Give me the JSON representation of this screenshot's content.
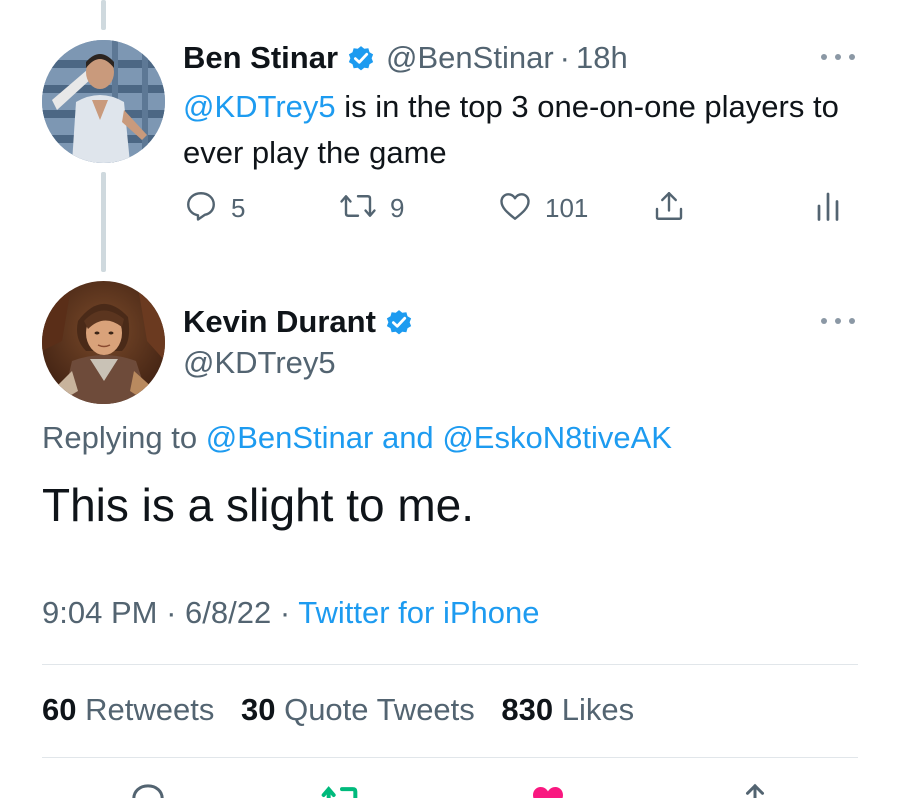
{
  "parent_tweet": {
    "author_name": "Ben Stinar",
    "handle": "@BenStinar",
    "separator": "·",
    "time": "18h",
    "mention": "@KDTrey5",
    "text": " is in the top 3 one-on-one players to ever play the game",
    "actions": {
      "replies": "5",
      "retweets": "9",
      "likes": "101"
    }
  },
  "reply_tweet": {
    "author_name": "Kevin Durant",
    "handle": "@KDTrey5",
    "replying_prefix": "Replying to",
    "replying_user_1": "@BenStinar",
    "replying_and": "and",
    "replying_user_2": "@EskoN8tiveAK",
    "text": "This is a slight to me.",
    "time": "9:04 PM",
    "date": "6/8/22",
    "separator": "·",
    "source": "Twitter for iPhone"
  },
  "stats": {
    "retweets_count": "60",
    "retweets_label": "Retweets",
    "quotes_count": "30",
    "quotes_label": "Quote Tweets",
    "likes_count": "830",
    "likes_label": "Likes"
  },
  "colors": {
    "accent": "#1d9bf0",
    "secondary_text": "#536471",
    "primary_text": "#0f1419",
    "retweet_green": "#00ba7c",
    "like_pink": "#f91880"
  },
  "icons": [
    "verified-badge-icon",
    "more-icon",
    "reply-icon",
    "retweet-icon",
    "like-icon",
    "share-icon",
    "analytics-icon"
  ]
}
